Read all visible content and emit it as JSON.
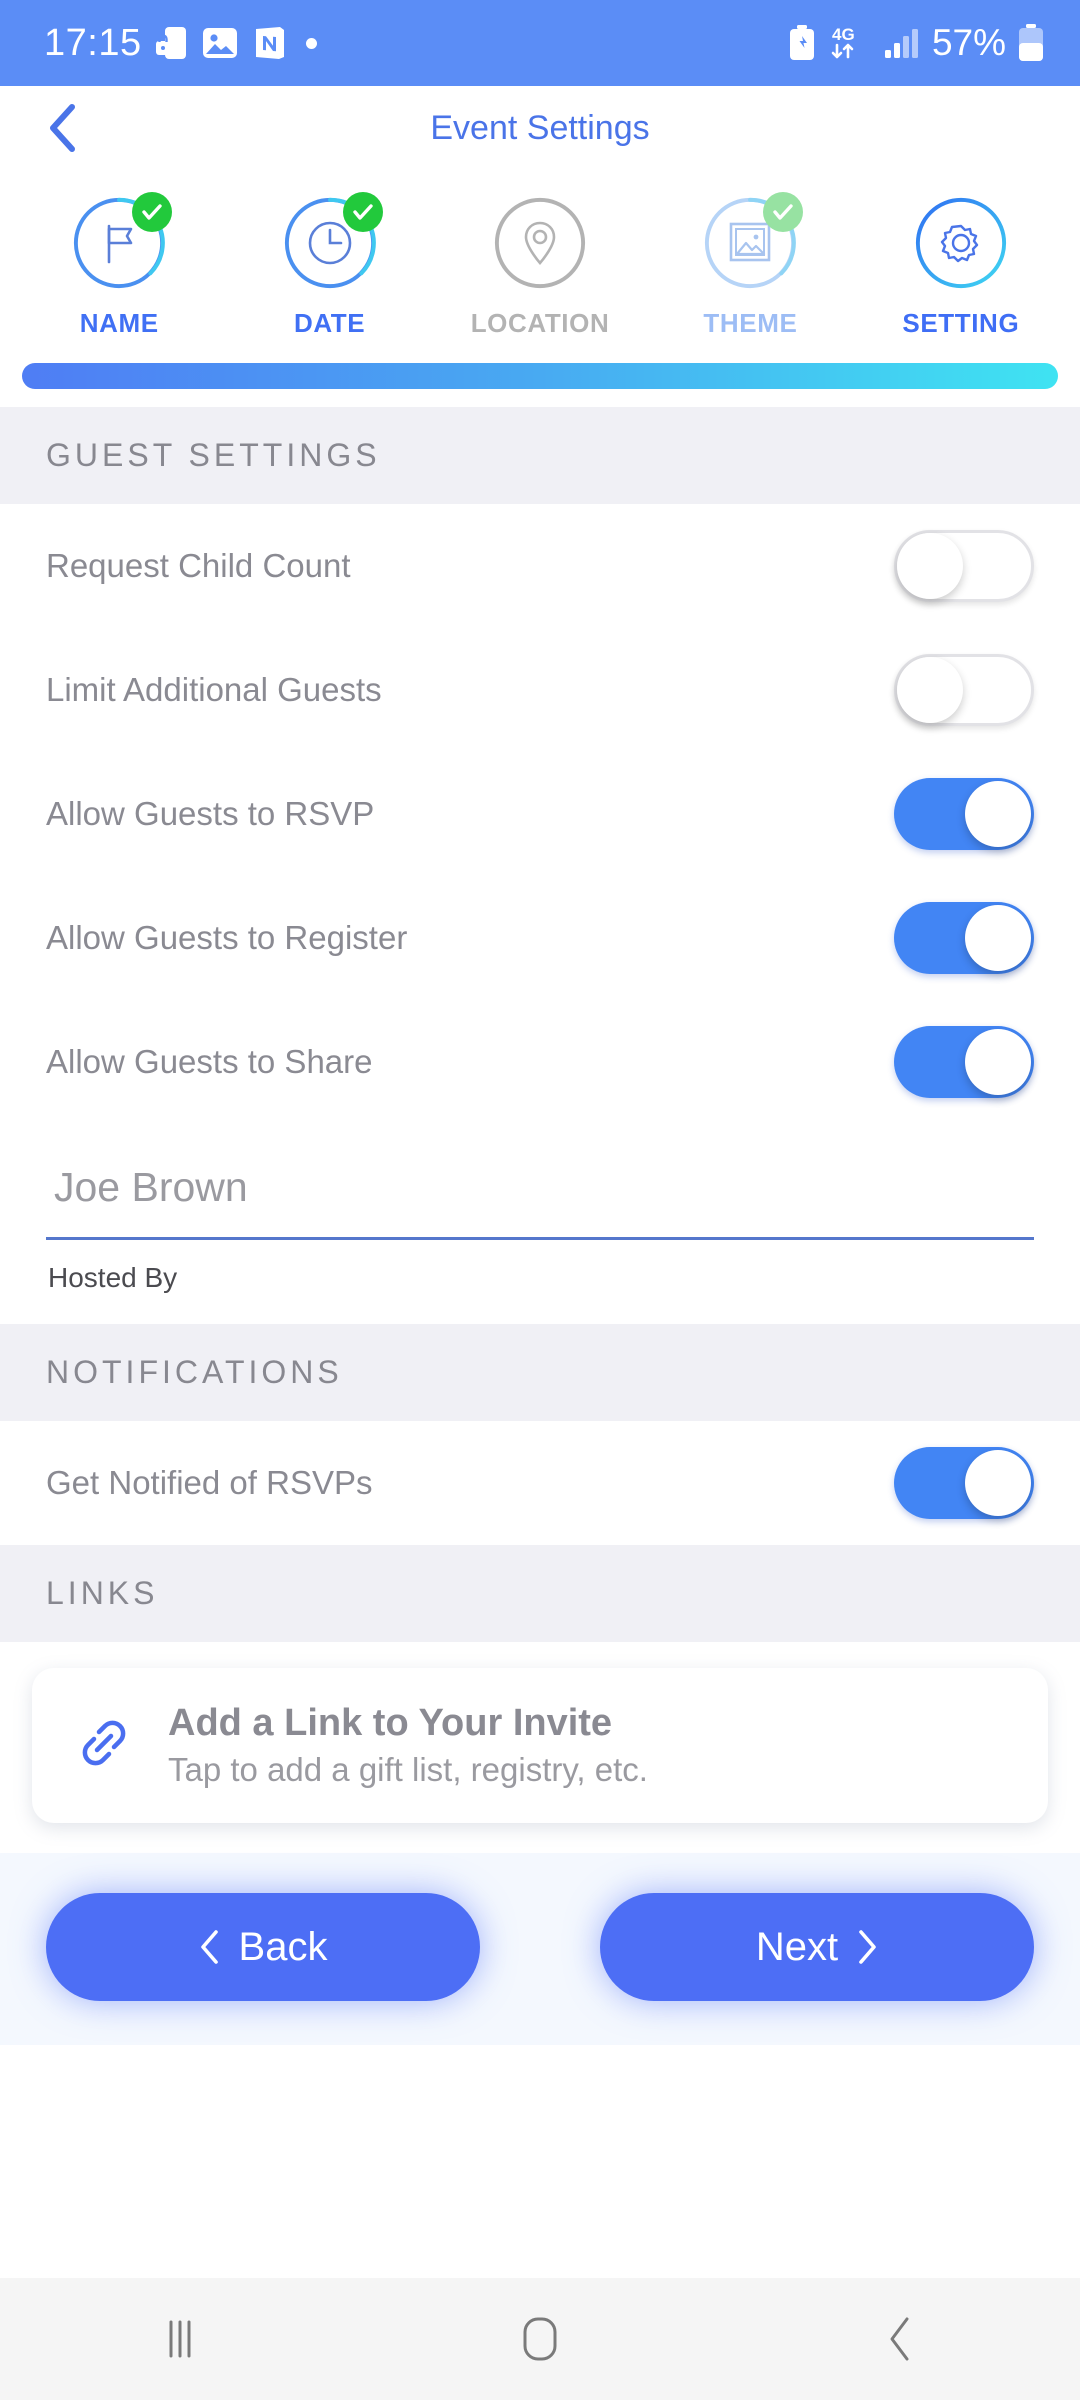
{
  "status_bar": {
    "time": "17:15",
    "left_icons": [
      "secure-phone-icon",
      "gallery-icon",
      "notion-icon",
      "dot-indicator"
    ],
    "network_type": "4G",
    "battery_percent": "57%",
    "right_icons": [
      "battery-saver-icon",
      "data-transfer-icon",
      "signal-bars-icon",
      "battery-icon"
    ],
    "background_color": "#5b8df6"
  },
  "header": {
    "title": "Event Settings",
    "back_icon": "chevron-left-icon",
    "title_color": "#4a74e8"
  },
  "stepper": {
    "steps": [
      {
        "label": "NAME",
        "icon": "flag-icon",
        "state": "complete",
        "completed": true,
        "label_color": "#4070f4",
        "ring_color": "#4a90f0"
      },
      {
        "label": "DATE",
        "icon": "clock-icon",
        "state": "complete",
        "completed": true,
        "label_color": "#4070f4",
        "ring_color": "#4a90f0"
      },
      {
        "label": "LOCATION",
        "icon": "pin-icon",
        "state": "incomplete",
        "completed": false,
        "label_color": "#b3b3b3",
        "ring_color": "#b3b3b3"
      },
      {
        "label": "THEME",
        "icon": "image-icon",
        "state": "partial",
        "completed": true,
        "label_color": "#9dbdf5",
        "ring_color": "#9dc8f5"
      },
      {
        "label": "SETTING",
        "icon": "gear-icon",
        "state": "active",
        "completed": false,
        "label_color": "#3f6ef5",
        "ring_color": "#2f7ef0"
      }
    ]
  },
  "progress": {
    "percent": 100,
    "gradient_start": "#4f7df4",
    "gradient_end": "#3fe3f2"
  },
  "sections": [
    {
      "title": "GUEST SETTINGS",
      "rows": [
        {
          "label": "Request Child Count",
          "toggle": "off"
        },
        {
          "label": "Limit Additional Guests",
          "toggle": "off"
        },
        {
          "label": "Allow Guests to RSVP",
          "toggle": "on"
        },
        {
          "label": "Allow Guests to Register",
          "toggle": "on"
        },
        {
          "label": "Allow Guests to Share",
          "toggle": "on"
        }
      ]
    },
    {
      "title": "NOTIFICATIONS",
      "rows": [
        {
          "label": "Get Notified of RSVPs",
          "toggle": "on"
        }
      ]
    },
    {
      "title": "LINKS",
      "rows": []
    }
  ],
  "host_field": {
    "value": "Joe Brown",
    "placeholder": "Joe Brown",
    "caption": "Hosted By",
    "underline_color": "#5577cc"
  },
  "link_card": {
    "icon": "link-chain-icon",
    "icon_color": "#4a6ef0",
    "title": "Add a Link to Your Invite",
    "subtitle": "Tap to add a gift list, registry, etc."
  },
  "bottom_buttons": {
    "back": {
      "label": "Back",
      "icon": "chevron-left-icon"
    },
    "next": {
      "label": "Next",
      "icon": "chevron-right-icon"
    },
    "color": "#4d6ef5"
  },
  "nav_bar": {
    "recents_icon": "recents-icon",
    "home_icon": "home-icon",
    "back_icon": "back-icon"
  },
  "toggle_colors": {
    "on": "#4285f4",
    "off_border": "#e2e2e6"
  }
}
